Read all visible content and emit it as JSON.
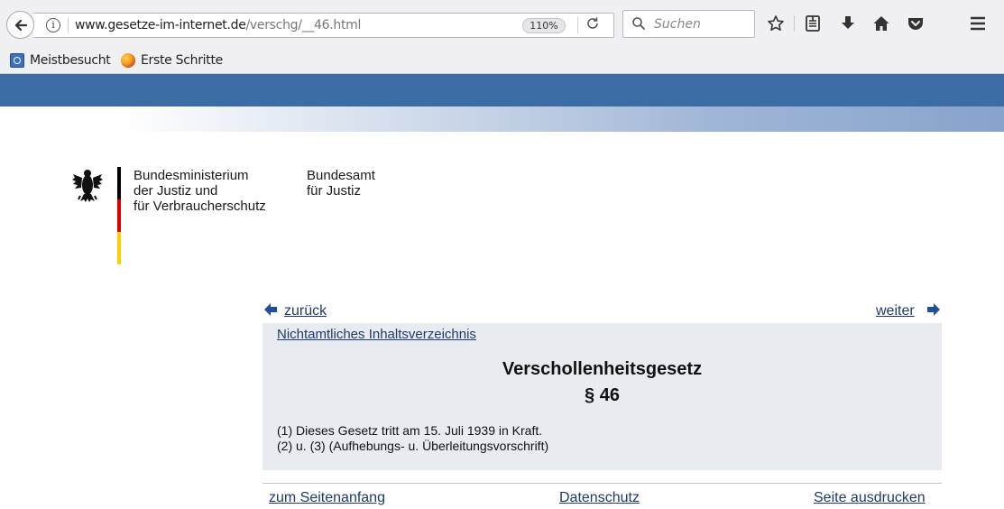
{
  "browser": {
    "url_host": "www.gesetze-im-internet.de",
    "url_path": "/verschg/__46.html",
    "zoom": "110%",
    "search_placeholder": "Suchen",
    "bookmarks": [
      {
        "label": "Meistbesucht",
        "icon": "bookmark-folder-icon"
      },
      {
        "label": "Erste Schritte",
        "icon": "firefox-icon"
      }
    ],
    "toolbar_icons": [
      "star-icon",
      "reading-list-icon",
      "download-icon",
      "home-icon",
      "pocket-icon",
      "menu-icon"
    ]
  },
  "logo": {
    "ministry": [
      "Bundesministerium",
      "der Justiz und",
      "für Verbraucherschutz"
    ],
    "office": [
      "Bundesamt",
      "für Justiz"
    ],
    "flag_colors": [
      "#000000",
      "#dd0000",
      "#ffce00"
    ]
  },
  "nav": {
    "back": "zurück",
    "next": "weiter",
    "toc": "Nichtamtliches Inhaltsverzeichnis"
  },
  "law": {
    "title": "Verschollenheitsgesetz",
    "section": "§ 46",
    "paragraphs": [
      "(1) Dieses Gesetz tritt am 15. Juli 1939 in Kraft.",
      "(2) u. (3) (Aufhebungs- u. Überleitungsvorschrift)"
    ]
  },
  "footer": {
    "top": "zum Seitenanfang",
    "privacy": "Datenschutz",
    "print": "Seite ausdrucken"
  },
  "colors": {
    "header_blue": "#3b6ca3",
    "content_bg": "#e8ecf1",
    "link": "#1f3a6e"
  }
}
